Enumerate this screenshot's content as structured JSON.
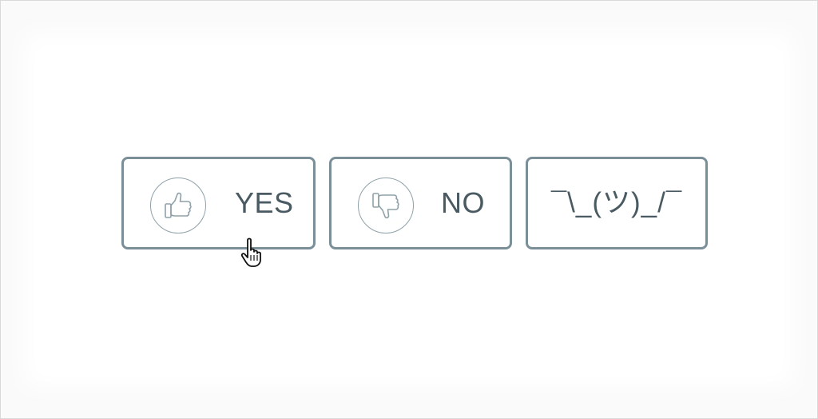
{
  "choices": [
    {
      "id": "yes",
      "label": "YES",
      "icon": "thumbs-up-icon"
    },
    {
      "id": "no",
      "label": "NO",
      "icon": "thumbs-down-icon"
    },
    {
      "id": "shrug",
      "label": "¯\\_(ツ)_/¯"
    }
  ],
  "colors": {
    "border": "#7b8f99",
    "text": "#4a5a62",
    "icon": "#8fa1a9",
    "background": "#ffffff"
  },
  "cursor": "hand-pointer-icon"
}
